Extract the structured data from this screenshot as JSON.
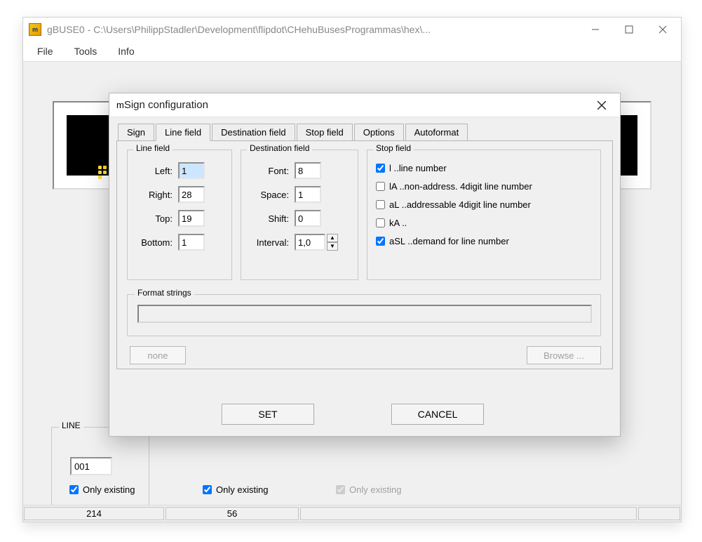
{
  "window": {
    "title": "gBUSE0 - C:\\Users\\PhilippStadler\\Development\\flipdot\\CHehuBusesProgrammas\\hex\\..."
  },
  "menu": {
    "file": "File",
    "tools": "Tools",
    "info": "Info"
  },
  "line_group": {
    "label": "LINE",
    "value": "001"
  },
  "checkboxes": {
    "only1": "Only existing",
    "only2": "Only existing",
    "only3": "Only existing"
  },
  "status": {
    "cell1": "214",
    "cell2": "56"
  },
  "dialog": {
    "title": "Sign configuration",
    "tabs": {
      "sign": "Sign",
      "line_field": "Line field",
      "dest_field": "Destination field",
      "stop_field": "Stop field",
      "options": "Options",
      "autoformat": "Autoformat"
    },
    "line_field_box": {
      "legend": "Line field",
      "left_label": "Left:",
      "left": "1",
      "right_label": "Right:",
      "right": "28",
      "top_label": "Top:",
      "top": "19",
      "bottom_label": "Bottom:",
      "bottom": "1"
    },
    "dest_field_box": {
      "legend": "Destination field",
      "font_label": "Font:",
      "font": "8",
      "space_label": "Space:",
      "space": "1",
      "shift_label": "Shift:",
      "shift": "0",
      "interval_label": "Interval:",
      "interval": "1,0"
    },
    "stop_field_box": {
      "legend": "Stop field",
      "l": "l   ..line number",
      "la": "lA ..non-address. 4digit line number",
      "al": "aL ..addressable 4digit line number",
      "ka": "kA ..",
      "asl": "aSL ..demand for line number"
    },
    "format": {
      "legend": "Format strings",
      "none": "none",
      "browse": "Browse ..."
    },
    "buttons": {
      "set": "SET",
      "cancel": "CANCEL"
    }
  }
}
